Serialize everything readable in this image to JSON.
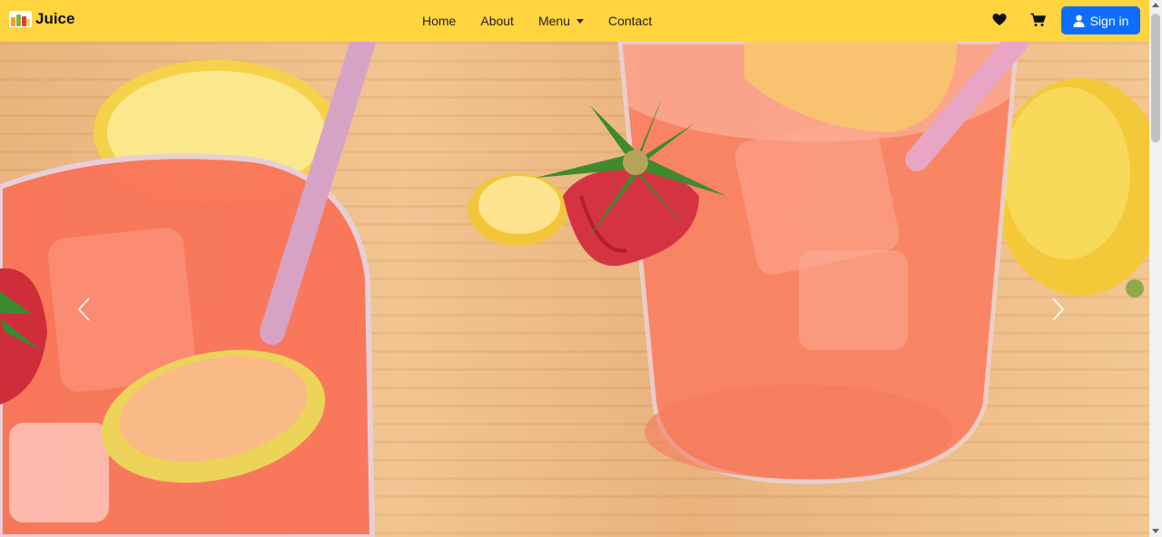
{
  "brand": {
    "name": "Juice",
    "logo_icon": "juice-bottles-icon"
  },
  "nav": {
    "items": [
      {
        "label": "Home"
      },
      {
        "label": "About"
      },
      {
        "label": "Menu",
        "has_dropdown": true
      },
      {
        "label": "Contact"
      }
    ]
  },
  "actions": {
    "favorites_icon": "heart-icon",
    "cart_icon": "cart-icon",
    "signin_label": "Sign in",
    "signin_icon": "user-icon"
  },
  "hero": {
    "image_description_icon": "strawberry-lemonade-image",
    "prev_icon": "chevron-left-icon",
    "next_icon": "chevron-right-icon"
  },
  "colors": {
    "navbar": "#ffd43f",
    "primary": "#0d6efd"
  }
}
